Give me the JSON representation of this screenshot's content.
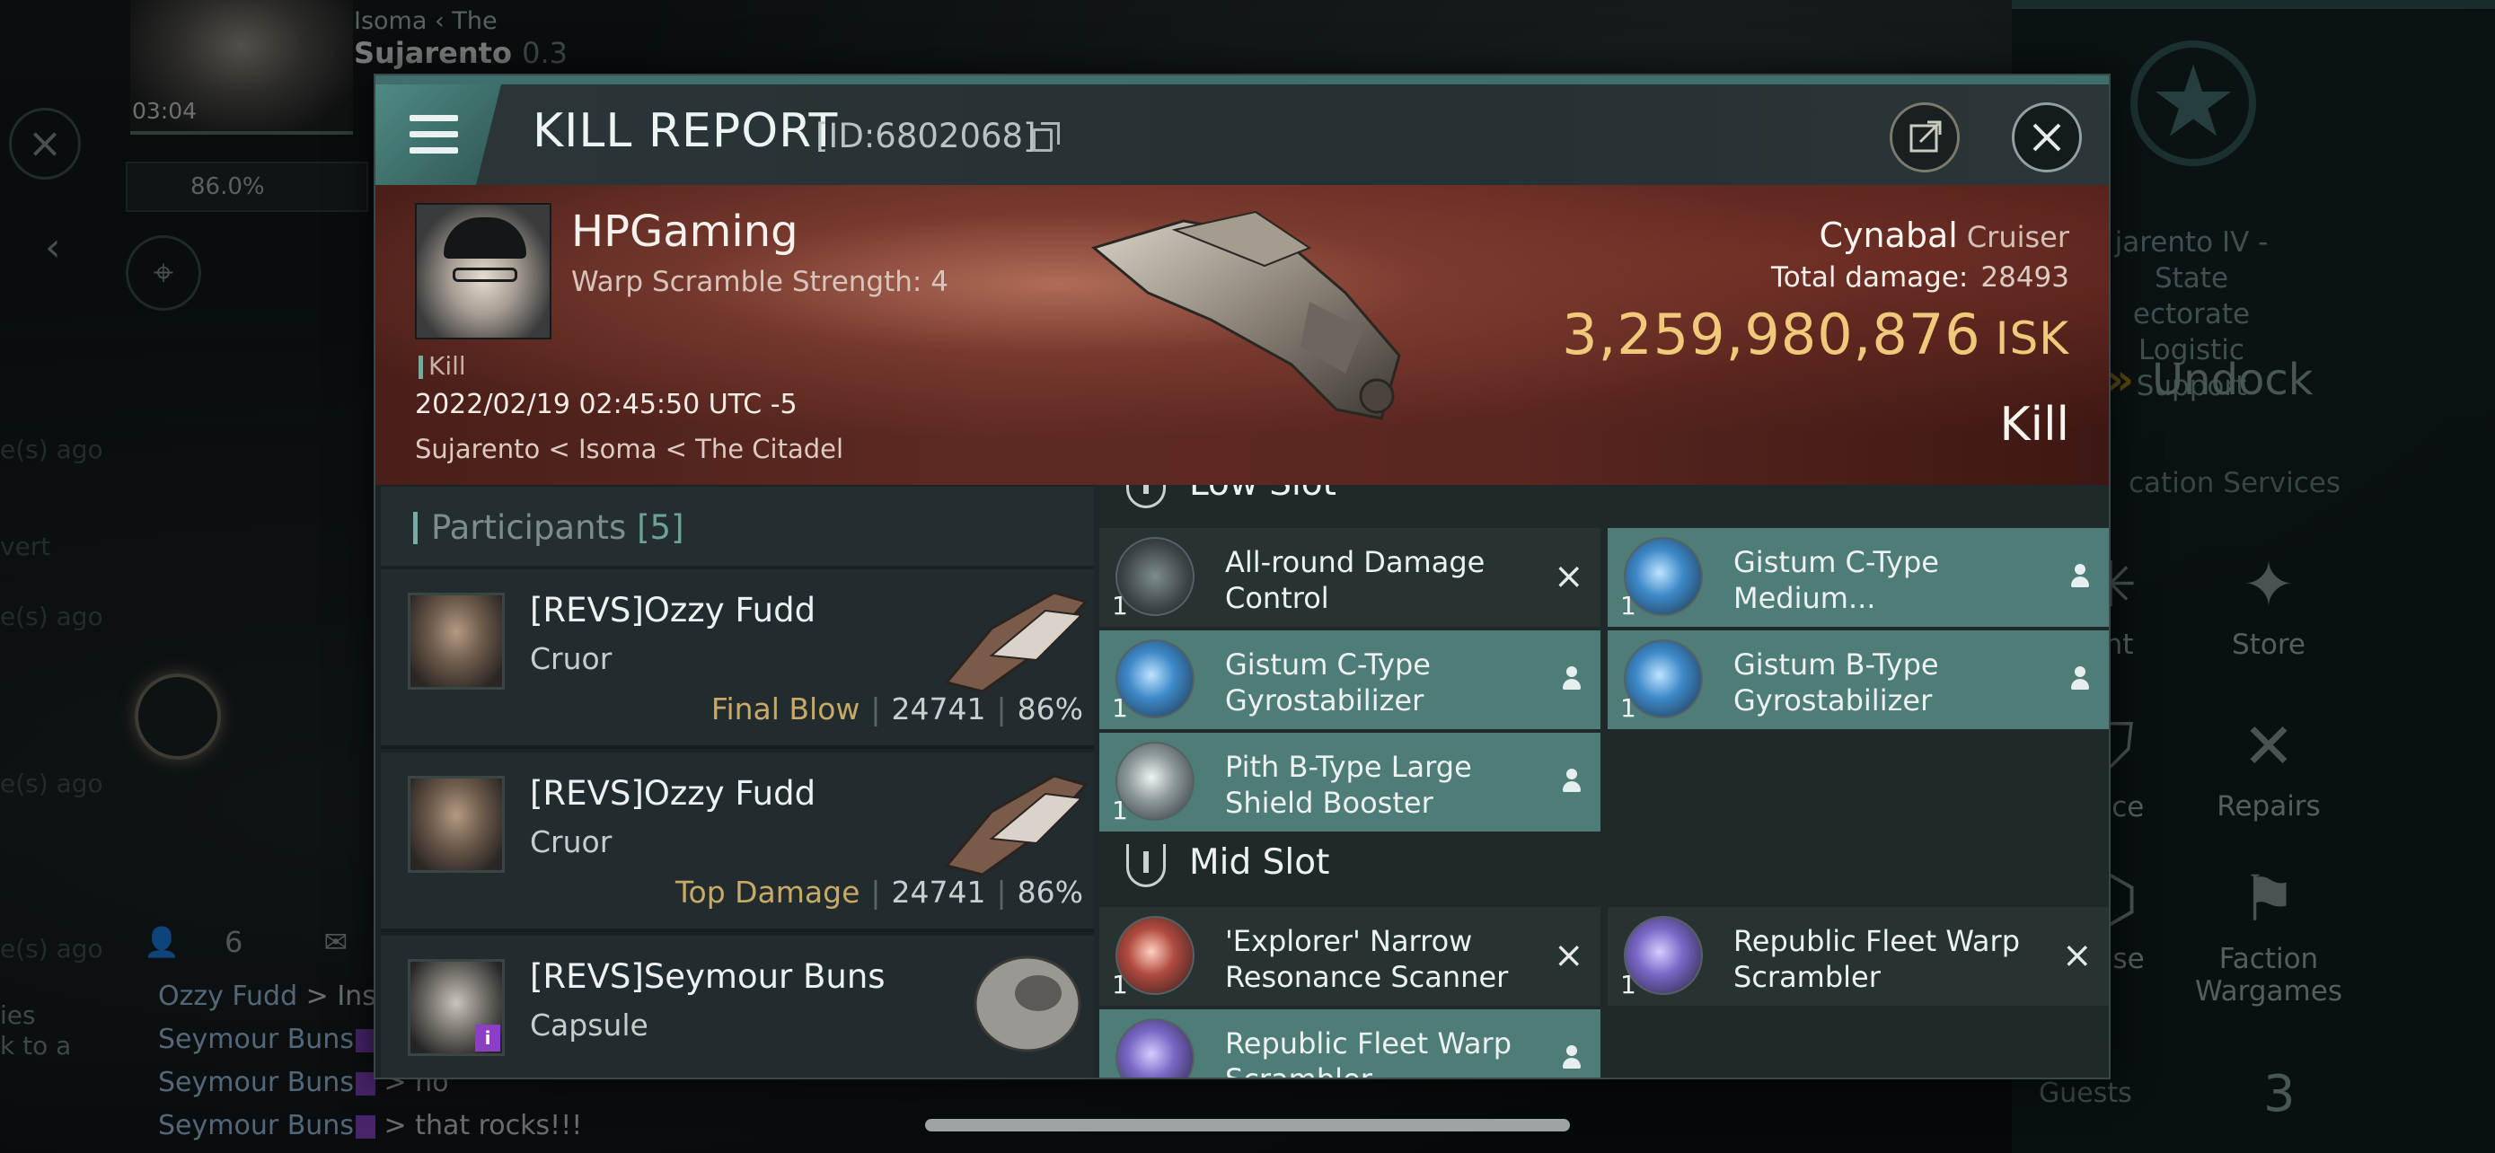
{
  "background": {
    "location_small": "Isoma ‹ The",
    "location_big": "Sujarento",
    "location_sec": "0.3",
    "time": "03:04",
    "stat": "86.0%",
    "faded_lines": [
      "e(s) ago",
      "vert",
      "e(s) ago",
      "e(s) ago",
      "e(s) ago",
      "ies",
      "k to a"
    ],
    "chat_count": "6",
    "chat": [
      {
        "from": "Ozzy Fudd",
        "text": " > Insa"
      },
      {
        "from": "Seymour Buns",
        "text": " > "
      },
      {
        "from": "Seymour Buns",
        "text": " > no"
      },
      {
        "from": "Seymour Buns",
        "text": " > that rocks!!!"
      }
    ],
    "station_lines": [
      "jarento IV - State",
      "ectorate Logistic",
      "Support"
    ],
    "undock_label": "Undock",
    "location_services": "cation Services",
    "services": [
      {
        "label": "ent",
        "icon": "sparkle-icon"
      },
      {
        "label": "Store",
        "icon": "nes-icon"
      },
      {
        "label": "ance",
        "icon": "insurance-icon"
      },
      {
        "label": "Repairs",
        "icon": "wrench-icon"
      },
      {
        "label": "Base",
        "icon": "base-icon"
      },
      {
        "label": "Faction\nWargames",
        "icon": "flags-icon"
      }
    ],
    "guests_label": "Guests",
    "guests_count": "3"
  },
  "report": {
    "title": "KILL REPORT",
    "id_text": "[ID:6802068]",
    "victim": {
      "name": "HPGaming",
      "subtitle": "Warp Scramble Strength: 4",
      "tag": "Kill",
      "datetime": "2022/02/19 02:45:50 UTC -5",
      "location": "Sujarento < Isoma < The Citadel"
    },
    "ship": {
      "name": "Cynabal",
      "class": "Cruiser",
      "total_damage_label": "Total damage:",
      "total_damage": "28493",
      "isk_value": "3,259,980,876",
      "isk_unit": "ISK",
      "result": "Kill"
    },
    "participants_label": "Participants",
    "participants_count": "[5]",
    "participants": [
      {
        "name": "[REVS]Ozzy Fudd",
        "ship": "Cruor",
        "tag": "Final Blow",
        "damage": "24741",
        "pct": "86%"
      },
      {
        "name": "[REVS]Ozzy Fudd",
        "ship": "Cruor",
        "tag": "Top Damage",
        "damage": "24741",
        "pct": "86%"
      },
      {
        "name": "[REVS]Seymour Buns",
        "ship": "Capsule"
      }
    ],
    "sections": {
      "low": "Low Slot",
      "mid": "Mid Slot"
    },
    "modules": [
      {
        "name": "All-round Damage Control",
        "qty": "1"
      },
      {
        "name": "Gistum C-Type Medium...",
        "qty": "1"
      },
      {
        "name": "Gistum C-Type Gyrostabilizer",
        "qty": "1"
      },
      {
        "name": "Gistum B-Type Gyrostabilizer",
        "qty": "1"
      },
      {
        "name": "Pith B-Type Large Shield Booster",
        "qty": "1"
      },
      {
        "name": "'Explorer' Narrow Resonance Scanner",
        "qty": "1"
      },
      {
        "name": "Republic Fleet Warp Scrambler",
        "qty": "1"
      },
      {
        "name": "Republic Fleet Warp Scrambler",
        "qty": "1"
      }
    ]
  }
}
